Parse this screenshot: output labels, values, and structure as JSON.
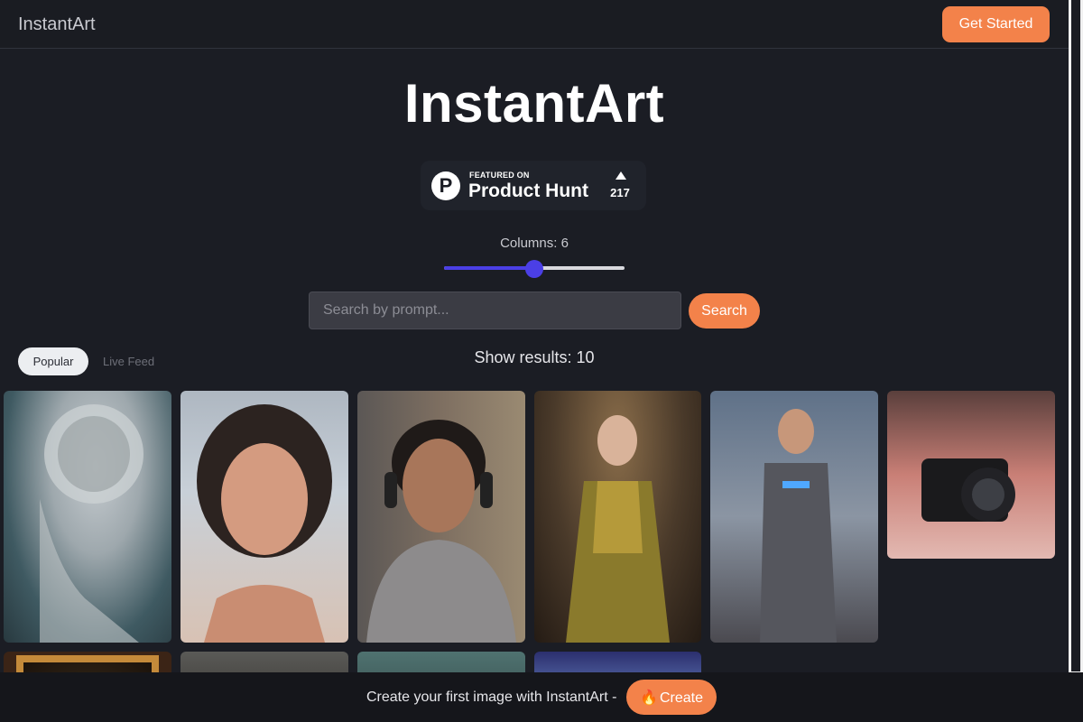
{
  "navbar": {
    "brand": "InstantArt",
    "cta_label": "Get Started"
  },
  "hero": {
    "title": "InstantArt"
  },
  "product_hunt": {
    "featured_text": "FEATURED ON",
    "name": "Product Hunt",
    "logo_letter": "P",
    "votes": "217"
  },
  "columns": {
    "label": "Columns: 6",
    "value": 6,
    "min": 1,
    "max": 11
  },
  "search": {
    "placeholder": "Search by prompt...",
    "value": "",
    "button_label": "Search"
  },
  "tabs": [
    {
      "label": "Popular",
      "active": true
    },
    {
      "label": "Live Feed",
      "active": false
    }
  ],
  "results": {
    "label": "Show results: 10"
  },
  "gallery": {
    "images": [
      {
        "name": "cyborg-anatomy-image"
      },
      {
        "name": "woman-portrait-image"
      },
      {
        "name": "man-headphones-image"
      },
      {
        "name": "golden-dress-woman-image"
      },
      {
        "name": "armored-warrior-image"
      },
      {
        "name": "camera-image"
      },
      {
        "name": "mona-lisa-frame-image"
      },
      {
        "name": "landscape-image"
      },
      {
        "name": "portrait-image"
      },
      {
        "name": "space-astronaut-image"
      }
    ]
  },
  "bottom_bar": {
    "text": "Create your first image with InstantArt -",
    "create_label": "Create",
    "create_icon": "fire-icon"
  },
  "colors": {
    "background": "#1b1d24",
    "accent": "#f3824a",
    "slider": "#4b3fe6"
  }
}
